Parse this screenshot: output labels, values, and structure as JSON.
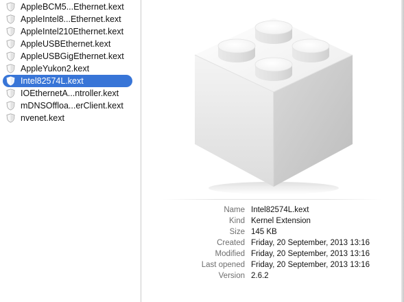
{
  "file_list": {
    "items": [
      {
        "label": "AppleBCM5...Ethernet.kext",
        "selected": false
      },
      {
        "label": "AppleIntel8...Ethernet.kext",
        "selected": false
      },
      {
        "label": "AppleIntel210Ethernet.kext",
        "selected": false
      },
      {
        "label": "AppleUSBEthernet.kext",
        "selected": false
      },
      {
        "label": "AppleUSBGigEthernet.kext",
        "selected": false
      },
      {
        "label": "AppleYukon2.kext",
        "selected": false
      },
      {
        "label": "Intel82574L.kext",
        "selected": true
      },
      {
        "label": "IOEthernetA...ntroller.kext",
        "selected": false
      },
      {
        "label": "mDNSOffloa...erClient.kext",
        "selected": false
      },
      {
        "label": "nvenet.kext",
        "selected": false
      }
    ],
    "item_icon": "kext-shield-icon",
    "selection_color": "#3875d7"
  },
  "preview": {
    "icon": "kernel-extension-lego-brick-icon",
    "info": {
      "name": {
        "label": "Name",
        "value": "Intel82574L.kext"
      },
      "kind": {
        "label": "Kind",
        "value": "Kernel Extension"
      },
      "size": {
        "label": "Size",
        "value": "145 KB"
      },
      "created": {
        "label": "Created",
        "value": "Friday, 20 September, 2013 13:16"
      },
      "modified": {
        "label": "Modified",
        "value": "Friday, 20 September, 2013 13:16"
      },
      "last_opened": {
        "label": "Last opened",
        "value": "Friday, 20 September, 2013 13:16"
      },
      "version": {
        "label": "Version",
        "value": "2.6.2"
      }
    }
  }
}
